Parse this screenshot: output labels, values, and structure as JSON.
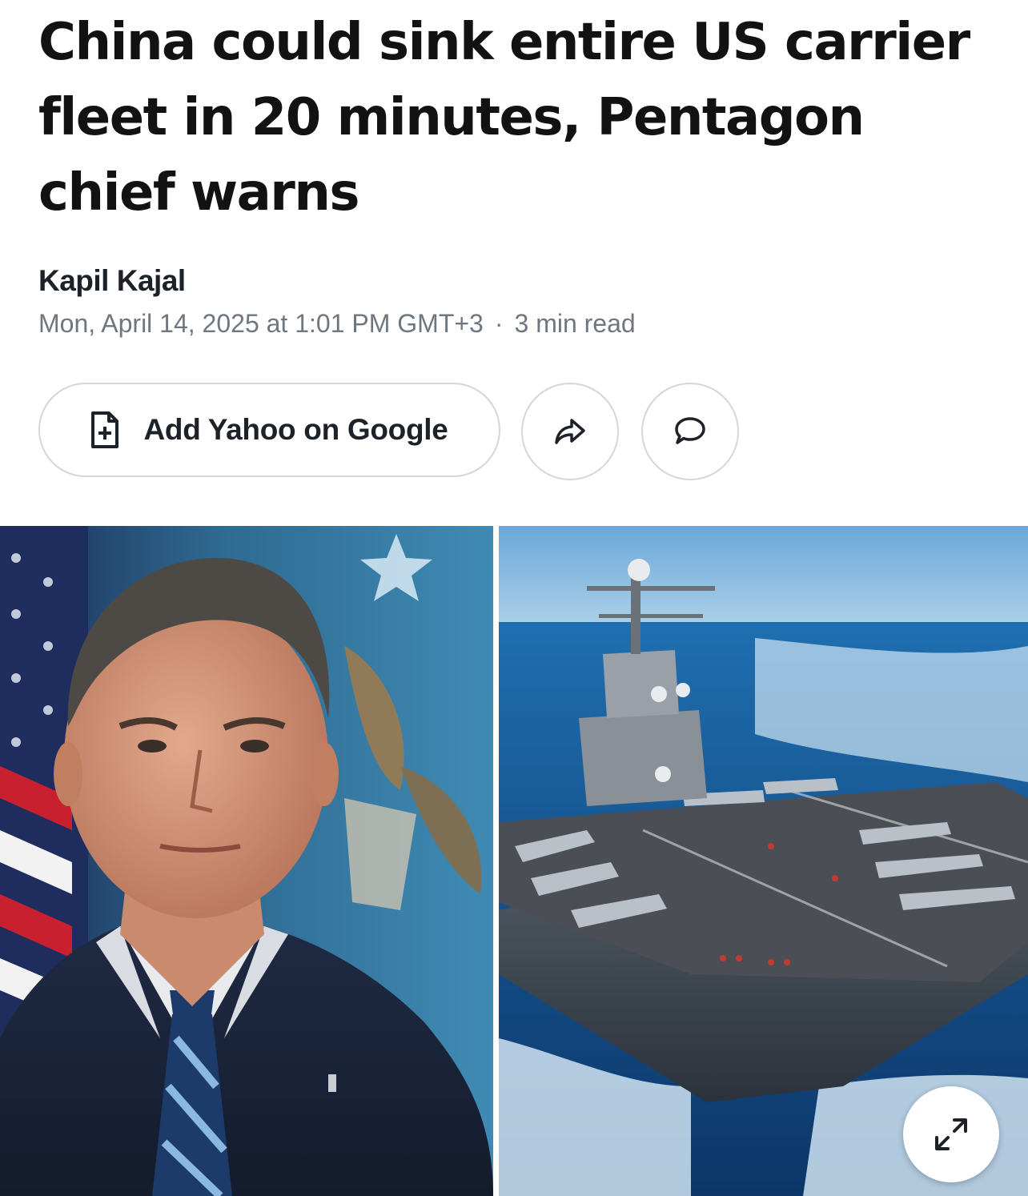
{
  "article": {
    "headline": "China could sink entire US carrier fleet in 20 minutes, Pentagon chief warns",
    "author": "Kapil Kajal",
    "date": "Mon, April 14, 2025 at 1:01 PM GMT+3",
    "separator": "·",
    "read_time": "3 min read"
  },
  "actions": {
    "add_google_label": "Add Yahoo on Google",
    "add_google_icon": "add-document-icon",
    "share_icon": "share-arrow-icon",
    "comment_icon": "speech-bubble-icon"
  },
  "media": {
    "left_image": "portrait of man in suit and striped tie in front of flags",
    "right_image": "aircraft carrier at sea with jets on deck",
    "expand_icon": "expand-arrows-icon"
  },
  "colors": {
    "text_primary": "#1d2228",
    "text_meta": "#6e7780",
    "button_border": "#d4d6d9"
  }
}
